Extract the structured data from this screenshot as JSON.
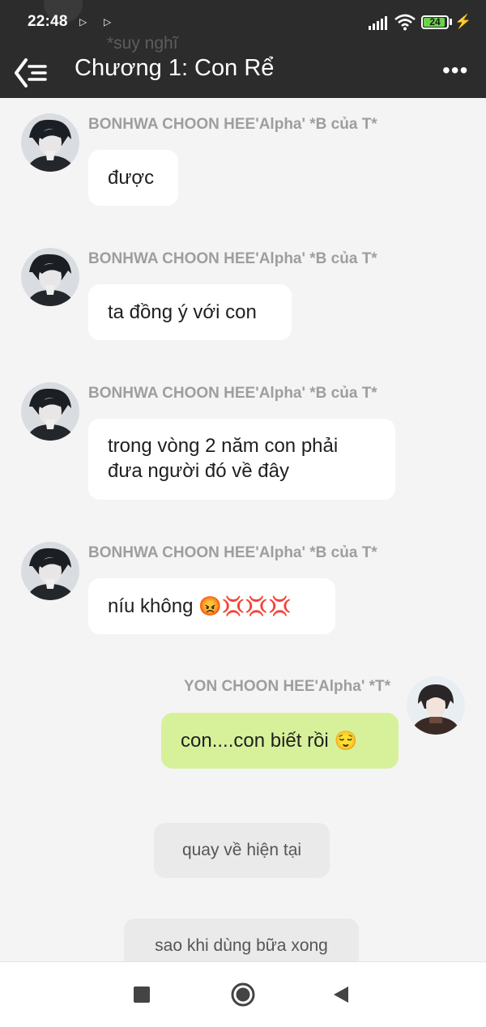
{
  "status_bar": {
    "time": "22:48",
    "battery": "24"
  },
  "behind_header": {
    "text": "*suy nghĩ"
  },
  "header": {
    "title": "Chương 1: Con Rể"
  },
  "messages": [
    {
      "sender": "BONHWA CHOON HEE'Alpha' *B của T*",
      "text": "được"
    },
    {
      "sender": "BONHWA CHOON HEE'Alpha' *B của T*",
      "text": "ta đồng ý với con"
    },
    {
      "sender": "BONHWA CHOON HEE'Alpha' *B của T*",
      "text_line1": "trong vòng 2 năm con phải",
      "text_line2": "đưa người đó về đây"
    },
    {
      "sender": "BONHWA CHOON HEE'Alpha' *B của T*",
      "text": "níu không",
      "emoji": "😡💢💢💢"
    },
    {
      "sender": "YON CHOON HEE'Alpha' *T*",
      "text": "con....con biết rồi",
      "emoji": "😌"
    }
  ],
  "narrations": [
    {
      "text": "quay về hiện tại"
    },
    {
      "text": "sao khi dùng bữa xong"
    }
  ],
  "colors": {
    "header_bg": "#2c2c2c",
    "chat_bg": "#f4f4f4",
    "other_bubble": "#ffffff",
    "my_bubble": "#d7f19a",
    "narration_bubble": "#eaeaea",
    "sender_name": "#9e9e9e"
  }
}
